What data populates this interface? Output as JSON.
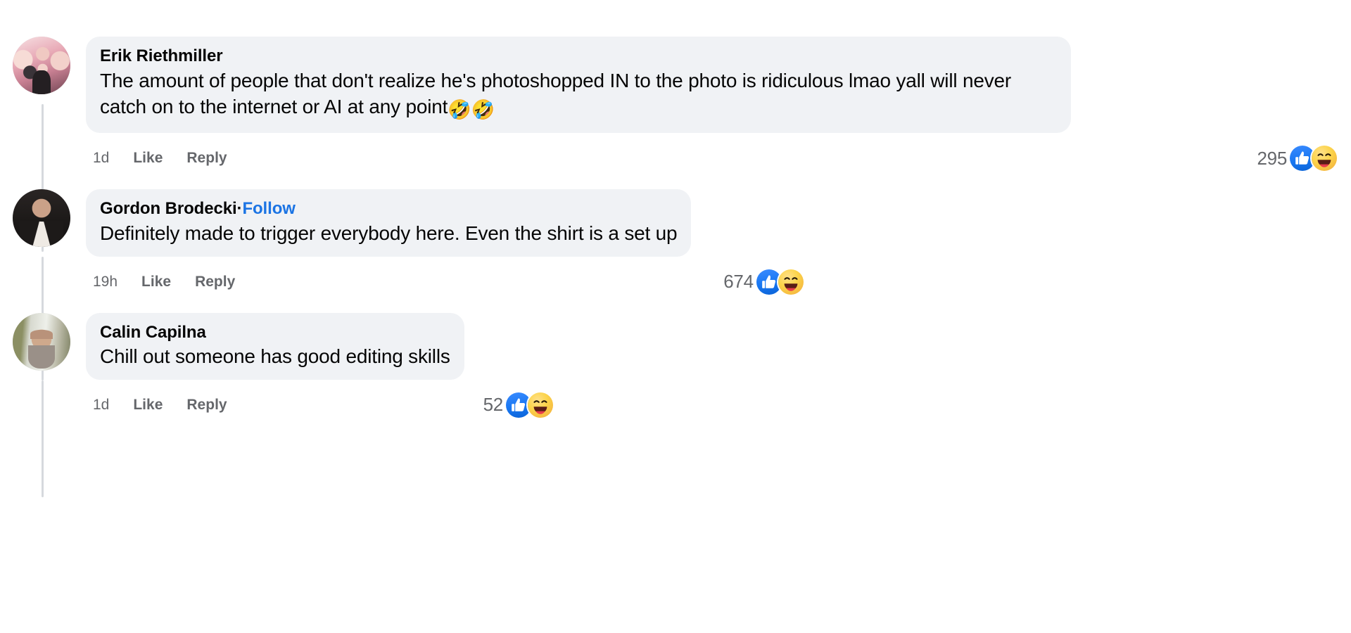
{
  "theme": {
    "bubble_bg": "#f0f2f5",
    "page_bg": "#ffffff",
    "text_primary": "#050505",
    "text_secondary": "#65676b",
    "link_blue": "#1b74e4",
    "like_blue": "#1877f2",
    "haha_yellow": "#f7b125",
    "thread_line": "#d6d9dd"
  },
  "comments": [
    {
      "id": "comment-1",
      "author": "Erik Riethmiller",
      "follow_label": "",
      "separator": "",
      "text": "The amount of people that don't realize he's photoshopped IN to the photo is ridiculous lmao yall will never catch on to the internet or AI at any point",
      "trailing_emojis": "🤣🤣",
      "timestamp": "1d",
      "like_label": "Like",
      "reply_label": "Reply",
      "reaction_count": "295",
      "reactions": [
        "like-reaction-icon",
        "haha-reaction-icon"
      ],
      "avatar_name": "avatar-erik-riethmiller"
    },
    {
      "id": "comment-2",
      "author": "Gordon Brodecki",
      "separator": "·",
      "follow_label": "Follow",
      "text": "Definitely made to trigger everybody here. Even the shirt is a set up",
      "trailing_emojis": "",
      "timestamp": "19h",
      "like_label": "Like",
      "reply_label": "Reply",
      "reaction_count": "674",
      "reactions": [
        "like-reaction-icon",
        "haha-reaction-icon"
      ],
      "avatar_name": "avatar-gordon-brodecki"
    },
    {
      "id": "comment-3",
      "author": "Calin Capilna",
      "separator": "",
      "follow_label": "",
      "text": "Chill out someone has good editing skills",
      "trailing_emojis": "",
      "timestamp": "1d",
      "like_label": "Like",
      "reply_label": "Reply",
      "reaction_count": "52",
      "reactions": [
        "like-reaction-icon",
        "haha-reaction-icon"
      ],
      "avatar_name": "avatar-calin-capilna"
    }
  ]
}
